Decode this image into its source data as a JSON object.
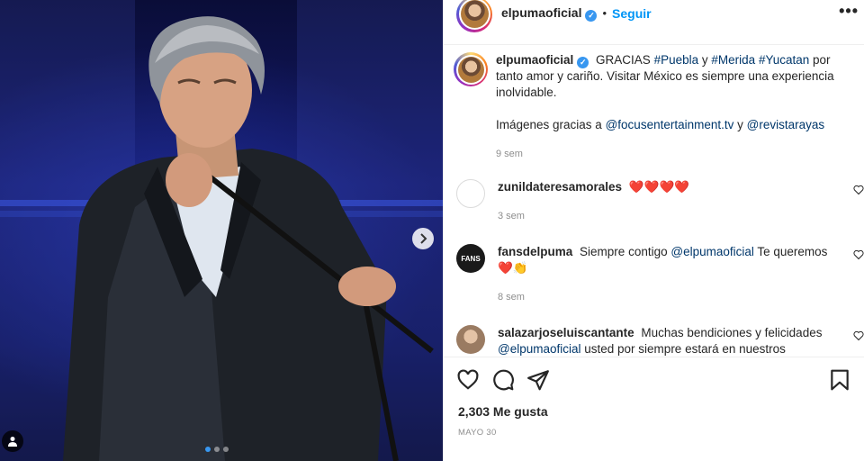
{
  "post": {
    "username": "elpumaoficial",
    "follow_label": "Seguir",
    "separator": "•",
    "more_label": "•••",
    "verified_mark": "✓"
  },
  "caption": {
    "username": "elpumaoficial",
    "text_1": "GRACIAS",
    "tag_1": "#Puebla",
    "text_2": "y",
    "tag_2": "#Merida",
    "tag_3": "#Yucatan",
    "text_3": "por tanto amor y cariño. Visitar México es siempre una experiencia inolvidable.",
    "text_4": "Imágenes gracias a",
    "mention_1": "@focusentertainment.tv",
    "text_5": "y",
    "mention_2": "@revistarayas",
    "time": "9 sem"
  },
  "comments": [
    {
      "username": "zunildateresamorales",
      "text": "",
      "emoji": "❤️❤️❤️❤️",
      "time": "3 sem"
    },
    {
      "username": "fansdelpuma",
      "text": "Siempre contigo",
      "mention": "@elpumaoficial",
      "text_after": "Te queremos",
      "emoji": "❤️👏",
      "time": "8 sem",
      "avatar_text": "FANS"
    },
    {
      "username": "salazarjoseluiscantante",
      "text": "Muchas bendiciones y felicidades",
      "mention": "@elpumaoficial",
      "text_after": "usted por siempre estará en nuestros"
    }
  ],
  "engagement": {
    "likes": "2,303 Me gusta",
    "date": "MAYO 30"
  },
  "carousel": {
    "count": 3,
    "active_index": 0
  },
  "icons": {
    "like": "heart-icon",
    "comment": "comment-icon",
    "share": "paper-plane-icon",
    "save": "bookmark-icon",
    "next": "chevron-right-icon",
    "tags": "user-tag-icon"
  },
  "colors": {
    "link": "#00376b",
    "follow": "#0095f6",
    "verified": "#3897f0",
    "meta": "#8e8e8e"
  }
}
